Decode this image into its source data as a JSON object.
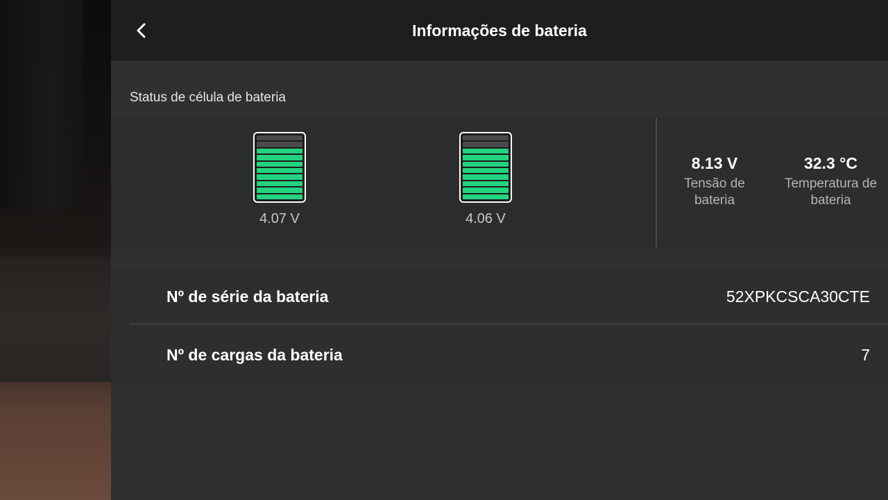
{
  "header": {
    "title": "Informações de bateria"
  },
  "cell_status": {
    "section_label": "Status de célula de bateria",
    "cells": [
      {
        "voltage": "4.07 V",
        "level_segments_filled": 8,
        "level_segments_total": 10
      },
      {
        "voltage": "4.06 V",
        "level_segments_filled": 8,
        "level_segments_total": 10
      }
    ],
    "fill_color": "#23d37f"
  },
  "stats": {
    "voltage": {
      "value": "8.13 V",
      "label_line1": "Tensão de",
      "label_line2": "bateria"
    },
    "temperature": {
      "value": "32.3 °C",
      "label_line1": "Temperatura de",
      "label_line2": "bateria"
    }
  },
  "info": {
    "serial": {
      "label": "Nº de série da bateria",
      "value": "52XPKCSCA30CTE"
    },
    "charges": {
      "label": "Nº de cargas da bateria",
      "value": "7"
    }
  },
  "icons": {
    "back": "chevron-left-icon"
  }
}
